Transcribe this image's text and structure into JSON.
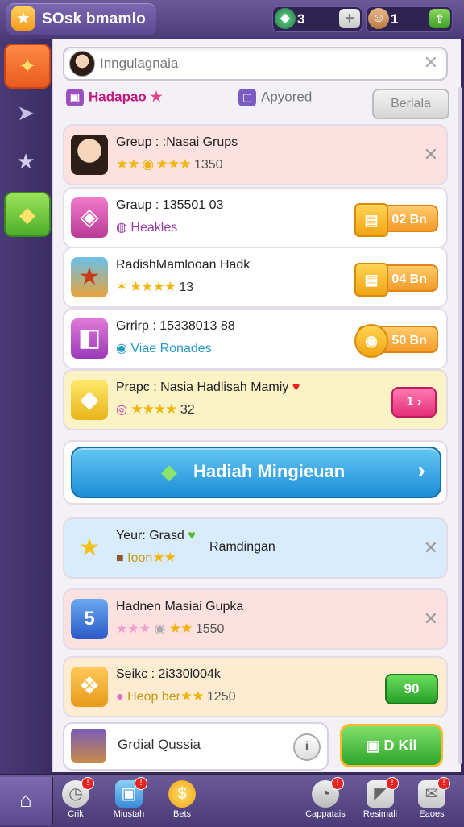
{
  "header": {
    "title": "SOsk bmamlo",
    "resource1": {
      "icon": "gem-icon",
      "value": "3"
    },
    "resource2": {
      "icon": "character-icon",
      "value": "1"
    }
  },
  "search": {
    "placeholder": "Inngulagnaia"
  },
  "tabs": [
    {
      "label": "Hadapao",
      "active": true
    },
    {
      "label": "Apyored",
      "active": false
    }
  ],
  "tab_button": "Berlala",
  "rows": [
    {
      "title": "Greup : :Nasai Grups",
      "sub_value": "1350",
      "type": "close",
      "color": "#fde0e0"
    },
    {
      "title": "Graup : 135501 03",
      "sub_text": "Heakles",
      "price": "02 Bn",
      "color": "#ffffff"
    },
    {
      "title": "RadishMamlooan Hadk",
      "sub_value": "13",
      "price": "04 Bn",
      "color": "#ffffff"
    },
    {
      "title": "Grrirp : 15338013 88",
      "sub_text": "Viae Ronades",
      "price": "50 Bn",
      "color": "#ffffff"
    },
    {
      "title": "Prapc : Nasia Hadlisah Mamiy",
      "sub_value": "32",
      "price": "1",
      "color": "#fbf3c6"
    }
  ],
  "big_button": {
    "label": "Hadiah Mingieuan"
  },
  "rows2": [
    {
      "title": "Yeur: Grasd",
      "sub_text": "Ioon",
      "right_text": "Ramdingan",
      "color": "#d9ecfb"
    },
    {
      "title": "Hadnen Masiai Gupka",
      "sub_value": "1550",
      "color": "#fde0e0"
    },
    {
      "title": "Seikc : 2i330l004k",
      "sub_text": "Heop ber",
      "sub_value": "1250",
      "price": "90",
      "color": "#fdebd2"
    }
  ],
  "bottom_card": {
    "label": "Grdial Qussia",
    "info": "i"
  },
  "kit_button": {
    "label": "D Kil"
  },
  "nav": [
    {
      "label": "",
      "icon": "home-icon"
    },
    {
      "label": "Crik",
      "icon": "clock-icon"
    },
    {
      "label": "Miustah",
      "icon": "box-icon"
    },
    {
      "label": "Bets",
      "icon": "coin-icon"
    },
    {
      "label": "Cappatais",
      "icon": "dial-icon"
    },
    {
      "label": "Resimali",
      "icon": "megaphone-icon"
    },
    {
      "label": "Eaoes",
      "icon": "mail-icon"
    }
  ]
}
